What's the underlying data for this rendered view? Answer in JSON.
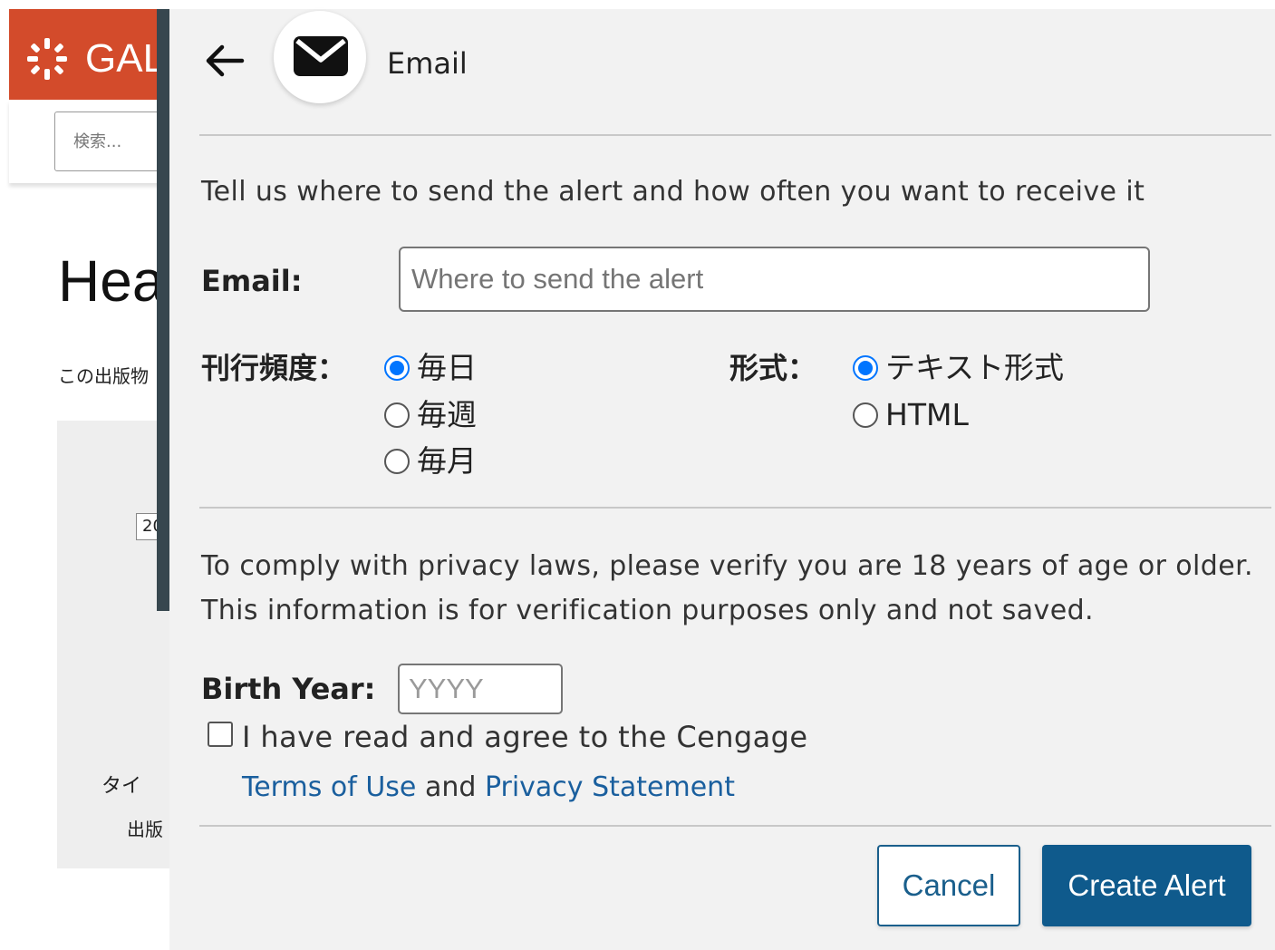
{
  "background": {
    "brand": "GAL",
    "search_placeholder": "検索...",
    "heading": "Hea",
    "intro": "この出版物",
    "box_chip": "20",
    "box_text_1": "タイ",
    "box_text_2": "出版"
  },
  "colors": {
    "header_bg": "#d34b2b",
    "panel_bg": "#f2f2f2",
    "primary_button": "#0f5a8c",
    "link": "#1a5f9e",
    "radio_checked": "#0075ff"
  },
  "panel": {
    "back_icon": "arrow-left-icon",
    "channel_icon": "envelope-icon",
    "title": "Email",
    "intro": "Tell us where to send the alert and how often you want to receive it",
    "email": {
      "label": "Email:",
      "placeholder": "Where to send the alert",
      "value": ""
    },
    "frequency": {
      "label": "刊行頻度：",
      "options": [
        "毎日",
        "毎週",
        "毎月"
      ],
      "selected": "毎日"
    },
    "format": {
      "label": "形式：",
      "options": [
        "テキスト形式",
        "HTML"
      ],
      "selected": "テキスト形式"
    },
    "privacy_text": "To comply with privacy laws, please verify you are 18 years of age or older. This information is for verification purposes only and not saved.",
    "birth_year": {
      "label": "Birth Year:",
      "placeholder": "YYYY",
      "value": ""
    },
    "agree": {
      "text": "I have read and agree to the Cengage",
      "checked": false,
      "terms_link": "Terms of Use",
      "and_text": "and",
      "privacy_link": "Privacy Statement"
    },
    "buttons": {
      "cancel": "Cancel",
      "create": "Create Alert"
    }
  }
}
